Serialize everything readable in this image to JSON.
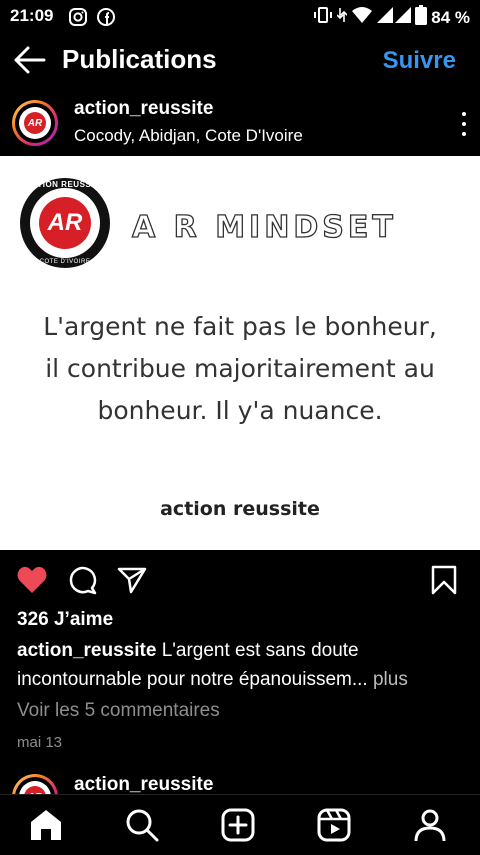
{
  "status": {
    "time": "21:09",
    "battery": "84 %"
  },
  "header": {
    "title": "Publications",
    "follow_label": "Suivre"
  },
  "post": {
    "username": "action_reussite",
    "location": "Cocody, Abidjan, Cote D'Ivoire",
    "image": {
      "logo_text_top": "ACTION REUSSITE",
      "logo_text_center": "AR",
      "logo_text_bottom": "COTE D'IVOIRE",
      "headline": "A R MINDSET",
      "quote": "L'argent ne fait pas le bonheur, il contribue majoritairement au bonheur. Il y'a nuance.",
      "signature": "action reussite"
    },
    "likes": "326 J’aime",
    "caption_user": "action_reussite",
    "caption_text": "L'argent est sans doute incontournable pour notre épanouissem...",
    "more_label": "plus",
    "comments_link": "Voir les 5 commentaires",
    "date": "mai 13",
    "liked": true,
    "accent_color": "#3797f0",
    "like_color": "#ed4956"
  },
  "next_post": {
    "username": "action_reussite"
  },
  "icons": {
    "status": [
      "instagram-icon",
      "facebook-icon",
      "vibrate-icon",
      "data-arrows-icon",
      "wifi-icon",
      "signal-icon",
      "battery-icon"
    ],
    "actions": [
      "heart-icon",
      "comment-icon",
      "share-icon",
      "bookmark-icon"
    ],
    "nav": [
      "home-icon",
      "search-icon",
      "create-icon",
      "reels-icon",
      "profile-icon"
    ]
  }
}
